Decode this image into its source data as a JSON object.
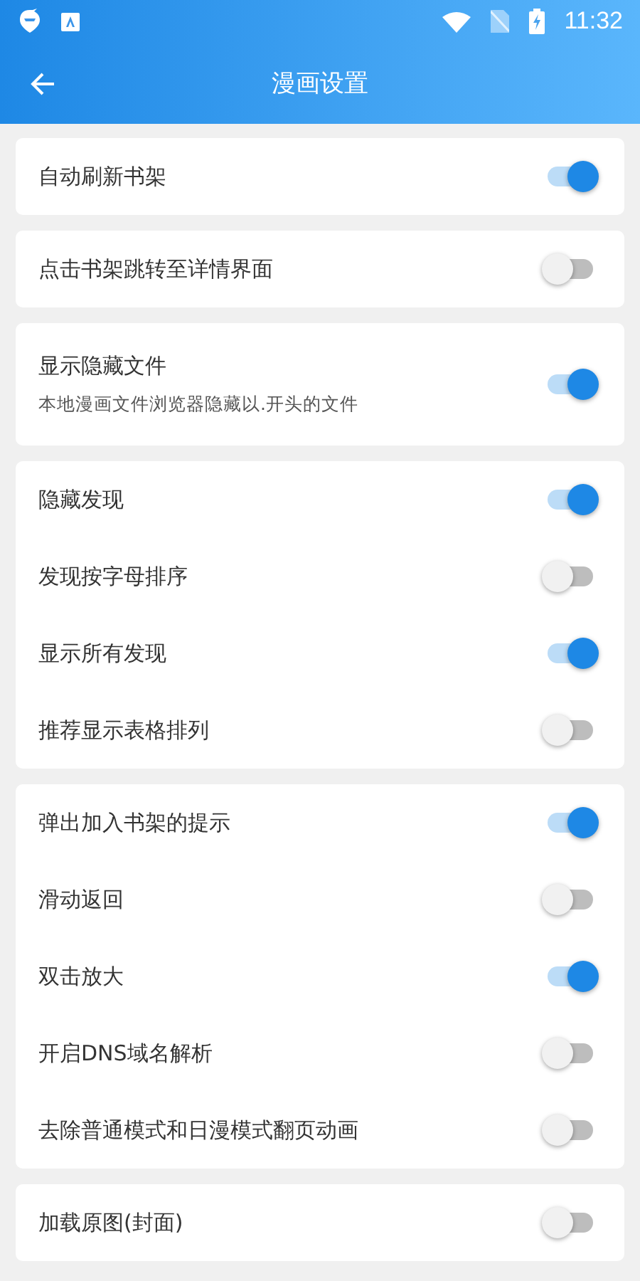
{
  "status_bar": {
    "time": "11:32"
  },
  "app_bar": {
    "title": "漫画设置"
  },
  "groups": [
    {
      "rows": [
        {
          "label": "自动刷新书架",
          "on": true
        }
      ]
    },
    {
      "rows": [
        {
          "label": "点击书架跳转至详情界面",
          "on": false
        }
      ]
    },
    {
      "rows": [
        {
          "label": "显示隐藏文件",
          "description": "本地漫画文件浏览器隐藏以.开头的文件",
          "on": true
        }
      ]
    },
    {
      "rows": [
        {
          "label": "隐藏发现",
          "on": true
        },
        {
          "label": "发现按字母排序",
          "on": false
        },
        {
          "label": "显示所有发现",
          "on": true
        },
        {
          "label": "推荐显示表格排列",
          "on": false
        }
      ]
    },
    {
      "rows": [
        {
          "label": "弹出加入书架的提示",
          "on": true
        },
        {
          "label": "滑动返回",
          "on": false
        },
        {
          "label": "双击放大",
          "on": true
        },
        {
          "label": "开启DNS域名解析",
          "on": false
        },
        {
          "label": "去除普通模式和日漫模式翻页动画",
          "on": false
        }
      ]
    },
    {
      "rows": [
        {
          "label": "加载原图(封面)",
          "on": false
        }
      ]
    }
  ]
}
